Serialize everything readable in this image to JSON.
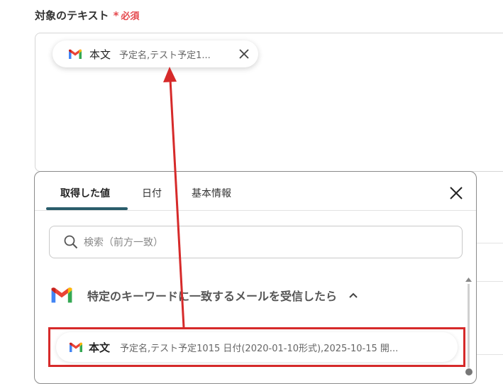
{
  "field": {
    "label": "対象のテキスト",
    "required_mark": "*",
    "required_text": "必須"
  },
  "chip": {
    "title": "本文",
    "preview": "予定名,テスト予定1..."
  },
  "panel": {
    "tabs": [
      {
        "label": "取得した値"
      },
      {
        "label": "日付"
      },
      {
        "label": "基本情報"
      }
    ],
    "search_placeholder": "検索（前方一致）",
    "section_title": "特定のキーワードに一致するメールを受信したら",
    "item": {
      "title": "本文",
      "preview": "予定名,テスト予定1015 日付(2020-01-10形式),2025-10-15 開..."
    }
  },
  "colors": {
    "annotation": "#d62a2a",
    "required": "#e5484d",
    "tab_active": "#2a5d6b"
  },
  "icons": [
    "gmail-icon",
    "close-icon",
    "search-icon",
    "chevron-up-icon"
  ]
}
